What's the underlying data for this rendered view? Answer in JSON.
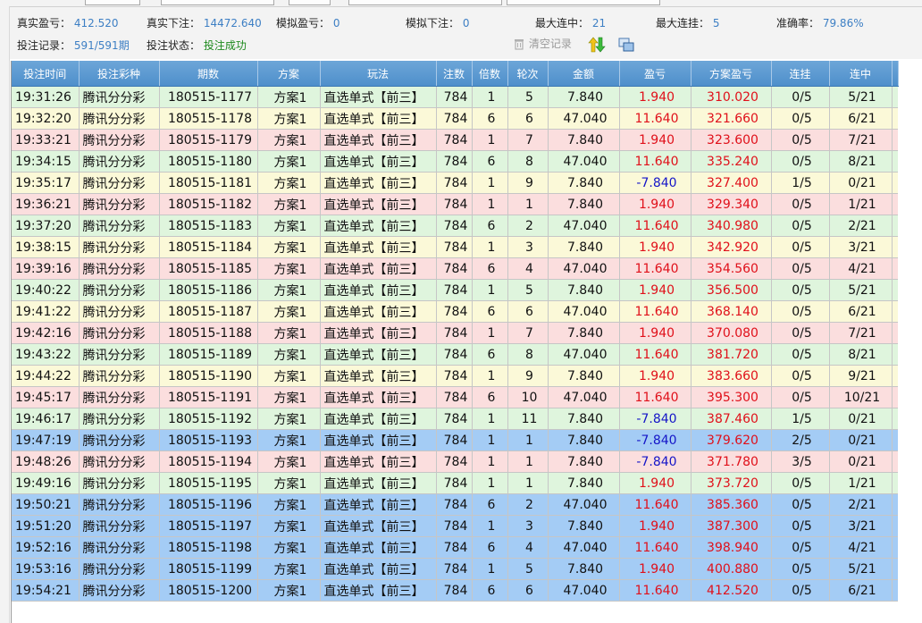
{
  "stats": {
    "real_profit_label": "真实盈亏：",
    "real_profit_value": "412.520",
    "real_bet_label": "真实下注：",
    "real_bet_value": "14472.640",
    "sim_profit_label": "模拟盈亏：",
    "sim_profit_value": "0",
    "sim_bet_label": "模拟下注：",
    "sim_bet_value": "0",
    "max_win_streak_label": "最大连中：",
    "max_win_streak_value": "21",
    "max_loss_streak_label": "最大连挂：",
    "max_loss_streak_value": "5",
    "accuracy_label": "准确率：",
    "accuracy_value": "79.86%",
    "record_label": "投注记录：",
    "record_value": "591/591期",
    "status_label": "投注状态：",
    "status_value": "投注成功",
    "clear_button": "清空记录"
  },
  "colors": {
    "header_bg": "#5b9ad4",
    "row_green": "#dff5dd",
    "row_yellow": "#fbf9d8",
    "row_pink": "#fbdede",
    "row_blue": "#a4ccf5",
    "profit_red": "#e0101a",
    "loss_blue": "#1515c8",
    "stat_value": "#3d7fc4",
    "status_ok": "#1d8a1d"
  },
  "table": {
    "columns": [
      "投注时间",
      "投注彩种",
      "期数",
      "方案",
      "玩法",
      "注数",
      "倍数",
      "轮次",
      "金额",
      "盈亏",
      "方案盈亏",
      "连挂",
      "连中"
    ],
    "rows": [
      {
        "style": "green",
        "cells": [
          "19:31:26",
          "腾讯分分彩",
          "180515-1177",
          "方案1",
          "直选单式【前三】",
          "784",
          "1",
          "5",
          "7.840",
          "1.940",
          "310.020",
          "0/5",
          "5/21"
        ]
      },
      {
        "style": "yellow",
        "cells": [
          "19:32:20",
          "腾讯分分彩",
          "180515-1178",
          "方案1",
          "直选单式【前三】",
          "784",
          "6",
          "6",
          "47.040",
          "11.640",
          "321.660",
          "0/5",
          "6/21"
        ]
      },
      {
        "style": "pink",
        "cells": [
          "19:33:21",
          "腾讯分分彩",
          "180515-1179",
          "方案1",
          "直选单式【前三】",
          "784",
          "1",
          "7",
          "7.840",
          "1.940",
          "323.600",
          "0/5",
          "7/21"
        ]
      },
      {
        "style": "green",
        "cells": [
          "19:34:15",
          "腾讯分分彩",
          "180515-1180",
          "方案1",
          "直选单式【前三】",
          "784",
          "6",
          "8",
          "47.040",
          "11.640",
          "335.240",
          "0/5",
          "8/21"
        ]
      },
      {
        "style": "yellow",
        "cells": [
          "19:35:17",
          "腾讯分分彩",
          "180515-1181",
          "方案1",
          "直选单式【前三】",
          "784",
          "1",
          "9",
          "7.840",
          "-7.840",
          "327.400",
          "1/5",
          "0/21"
        ]
      },
      {
        "style": "pink",
        "cells": [
          "19:36:21",
          "腾讯分分彩",
          "180515-1182",
          "方案1",
          "直选单式【前三】",
          "784",
          "1",
          "1",
          "7.840",
          "1.940",
          "329.340",
          "0/5",
          "1/21"
        ]
      },
      {
        "style": "green",
        "cells": [
          "19:37:20",
          "腾讯分分彩",
          "180515-1183",
          "方案1",
          "直选单式【前三】",
          "784",
          "6",
          "2",
          "47.040",
          "11.640",
          "340.980",
          "0/5",
          "2/21"
        ]
      },
      {
        "style": "yellow",
        "cells": [
          "19:38:15",
          "腾讯分分彩",
          "180515-1184",
          "方案1",
          "直选单式【前三】",
          "784",
          "1",
          "3",
          "7.840",
          "1.940",
          "342.920",
          "0/5",
          "3/21"
        ]
      },
      {
        "style": "pink",
        "cells": [
          "19:39:16",
          "腾讯分分彩",
          "180515-1185",
          "方案1",
          "直选单式【前三】",
          "784",
          "6",
          "4",
          "47.040",
          "11.640",
          "354.560",
          "0/5",
          "4/21"
        ]
      },
      {
        "style": "green",
        "cells": [
          "19:40:22",
          "腾讯分分彩",
          "180515-1186",
          "方案1",
          "直选单式【前三】",
          "784",
          "1",
          "5",
          "7.840",
          "1.940",
          "356.500",
          "0/5",
          "5/21"
        ]
      },
      {
        "style": "yellow",
        "cells": [
          "19:41:22",
          "腾讯分分彩",
          "180515-1187",
          "方案1",
          "直选单式【前三】",
          "784",
          "6",
          "6",
          "47.040",
          "11.640",
          "368.140",
          "0/5",
          "6/21"
        ]
      },
      {
        "style": "pink",
        "cells": [
          "19:42:16",
          "腾讯分分彩",
          "180515-1188",
          "方案1",
          "直选单式【前三】",
          "784",
          "1",
          "7",
          "7.840",
          "1.940",
          "370.080",
          "0/5",
          "7/21"
        ]
      },
      {
        "style": "green",
        "cells": [
          "19:43:22",
          "腾讯分分彩",
          "180515-1189",
          "方案1",
          "直选单式【前三】",
          "784",
          "6",
          "8",
          "47.040",
          "11.640",
          "381.720",
          "0/5",
          "8/21"
        ]
      },
      {
        "style": "yellow",
        "cells": [
          "19:44:22",
          "腾讯分分彩",
          "180515-1190",
          "方案1",
          "直选单式【前三】",
          "784",
          "1",
          "9",
          "7.840",
          "1.940",
          "383.660",
          "0/5",
          "9/21"
        ]
      },
      {
        "style": "pink",
        "cells": [
          "19:45:17",
          "腾讯分分彩",
          "180515-1191",
          "方案1",
          "直选单式【前三】",
          "784",
          "6",
          "10",
          "47.040",
          "11.640",
          "395.300",
          "0/5",
          "10/21"
        ]
      },
      {
        "style": "green",
        "cells": [
          "19:46:17",
          "腾讯分分彩",
          "180515-1192",
          "方案1",
          "直选单式【前三】",
          "784",
          "1",
          "11",
          "7.840",
          "-7.840",
          "387.460",
          "1/5",
          "0/21"
        ]
      },
      {
        "style": "blue",
        "cells": [
          "19:47:19",
          "腾讯分分彩",
          "180515-1193",
          "方案1",
          "直选单式【前三】",
          "784",
          "1",
          "1",
          "7.840",
          "-7.840",
          "379.620",
          "2/5",
          "0/21"
        ]
      },
      {
        "style": "pink",
        "cells": [
          "19:48:26",
          "腾讯分分彩",
          "180515-1194",
          "方案1",
          "直选单式【前三】",
          "784",
          "1",
          "1",
          "7.840",
          "-7.840",
          "371.780",
          "3/5",
          "0/21"
        ]
      },
      {
        "style": "green",
        "cells": [
          "19:49:16",
          "腾讯分分彩",
          "180515-1195",
          "方案1",
          "直选单式【前三】",
          "784",
          "1",
          "1",
          "7.840",
          "1.940",
          "373.720",
          "0/5",
          "1/21"
        ]
      },
      {
        "style": "blue",
        "cells": [
          "19:50:21",
          "腾讯分分彩",
          "180515-1196",
          "方案1",
          "直选单式【前三】",
          "784",
          "6",
          "2",
          "47.040",
          "11.640",
          "385.360",
          "0/5",
          "2/21"
        ]
      },
      {
        "style": "blue",
        "cells": [
          "19:51:20",
          "腾讯分分彩",
          "180515-1197",
          "方案1",
          "直选单式【前三】",
          "784",
          "1",
          "3",
          "7.840",
          "1.940",
          "387.300",
          "0/5",
          "3/21"
        ]
      },
      {
        "style": "blue",
        "cells": [
          "19:52:16",
          "腾讯分分彩",
          "180515-1198",
          "方案1",
          "直选单式【前三】",
          "784",
          "6",
          "4",
          "47.040",
          "11.640",
          "398.940",
          "0/5",
          "4/21"
        ]
      },
      {
        "style": "blue",
        "cells": [
          "19:53:16",
          "腾讯分分彩",
          "180515-1199",
          "方案1",
          "直选单式【前三】",
          "784",
          "1",
          "5",
          "7.840",
          "1.940",
          "400.880",
          "0/5",
          "5/21"
        ]
      },
      {
        "style": "blue",
        "cells": [
          "19:54:21",
          "腾讯分分彩",
          "180515-1200",
          "方案1",
          "直选单式【前三】",
          "784",
          "6",
          "6",
          "47.040",
          "11.640",
          "412.520",
          "0/5",
          "6/21"
        ]
      }
    ]
  }
}
